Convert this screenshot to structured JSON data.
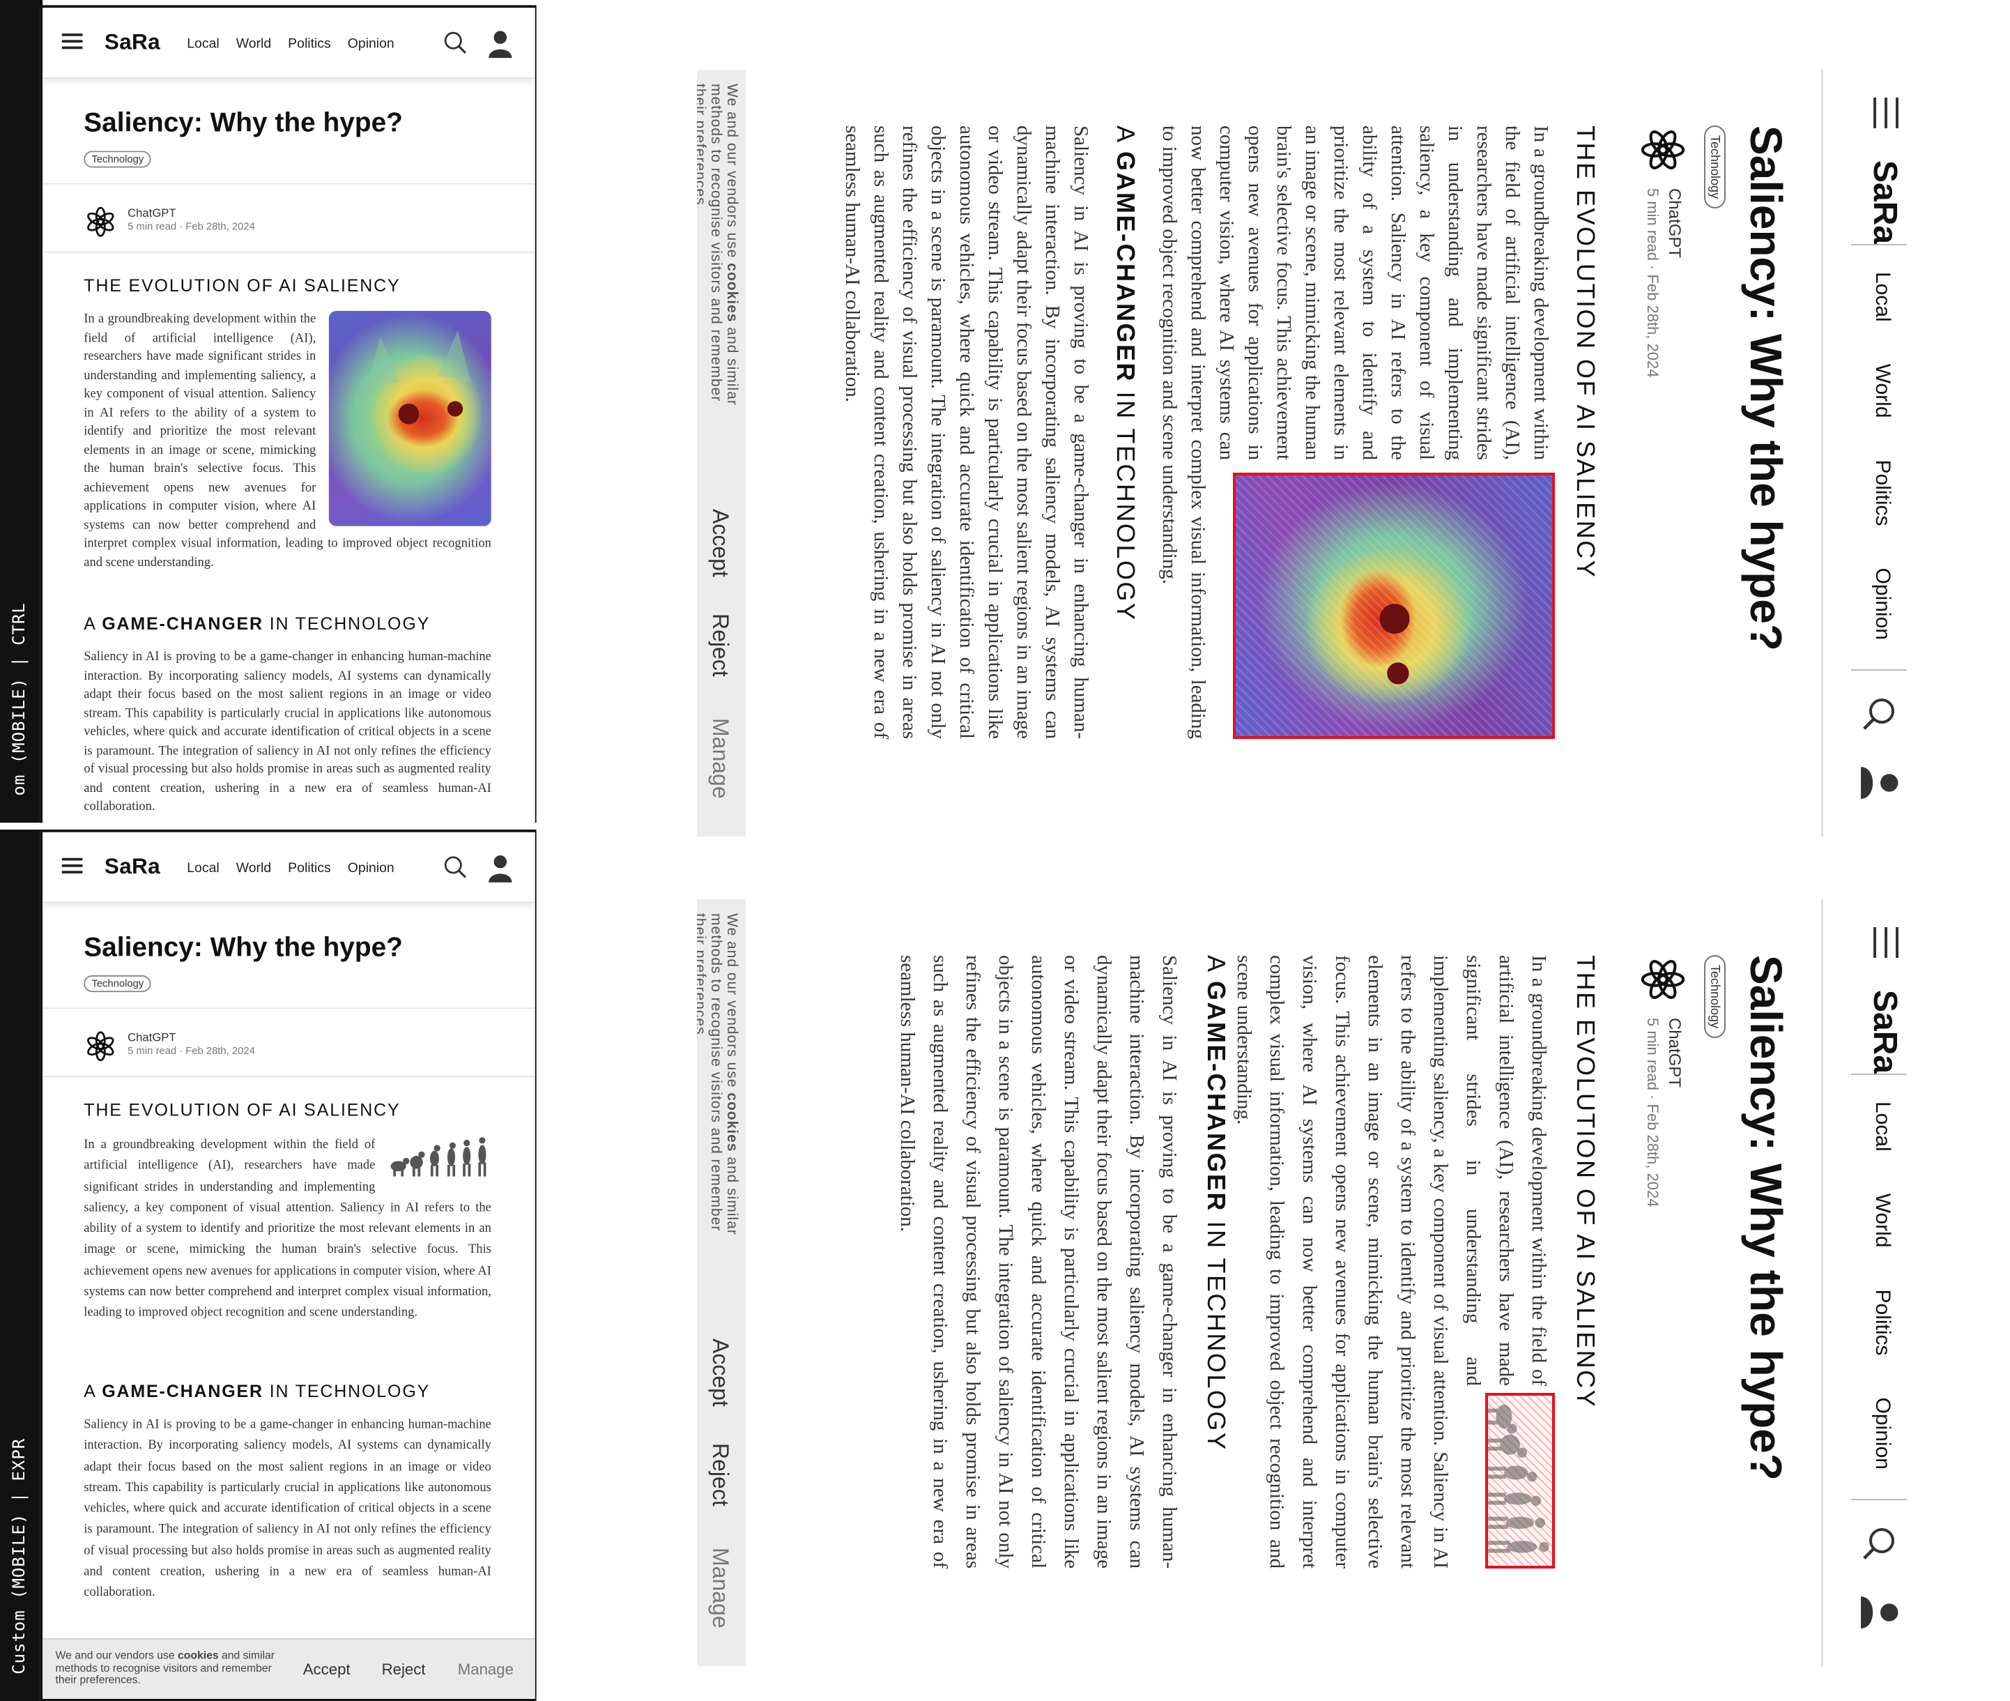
{
  "site": {
    "logo": "SaRa",
    "nav_links": [
      "Local",
      "World",
      "Politics",
      "Opinion"
    ]
  },
  "article": {
    "title": "Saliency: Why the hype?",
    "tag": "Technology",
    "author": "ChatGPT",
    "meta": "5 min read · Feb 28th, 2024",
    "section1_heading": "THE EVOLUTION OF AI SALIENCY",
    "section1_text": "In a groundbreaking development within the field of artificial intelligence (AI), researchers have made significant strides in understanding and implementing saliency, a key component of visual attention. Saliency in AI refers to the ability of a system to identify and prioritize the most relevant elements in an image or scene, mimicking the human brain's selective focus. This achievement opens new avenues for applications in computer vision, where AI systems can now better comprehend and interpret complex visual information, leading to improved object recognition and scene understanding.",
    "section2_heading_pre": "A",
    "section2_heading_bold": "GAME-CHANGER",
    "section2_heading_post": "IN TECHNOLOGY",
    "section2_text": "Saliency in AI is proving to be a game-changer in enhancing human-machine interaction. By incorporating saliency models, AI systems can dynamically adapt their focus based on the most salient regions in an image or video stream. This capability is particularly crucial in applications like autonomous vehicles, where quick and accurate identification of critical objects in a scene is paramount. The integration of saliency in AI not only refines the efficiency of visual processing but also holds promise in areas such as augmented reality and content creation, ushering in a new era of seamless human-AI collaboration."
  },
  "cookie": {
    "text_pre": "We and our vendors use",
    "text_bold": "cookies",
    "text_post": "and similar methods to recognise visitors and remember their preferences.",
    "accept": "Accept",
    "reject": "Reject",
    "manage": "Manage"
  },
  "panels": {
    "top_label": "om (MOBILE) | CTRL",
    "bottom_label": "Custom (MOBILE) | EXPR"
  },
  "images": {
    "cat": "cat-saliency-heatmap",
    "evolution": "human-evolution-silhouettes"
  },
  "colors": {
    "highlight_box": "#e1131e",
    "sidebar": "#121212",
    "cookie_bg": "#eaeaea"
  }
}
